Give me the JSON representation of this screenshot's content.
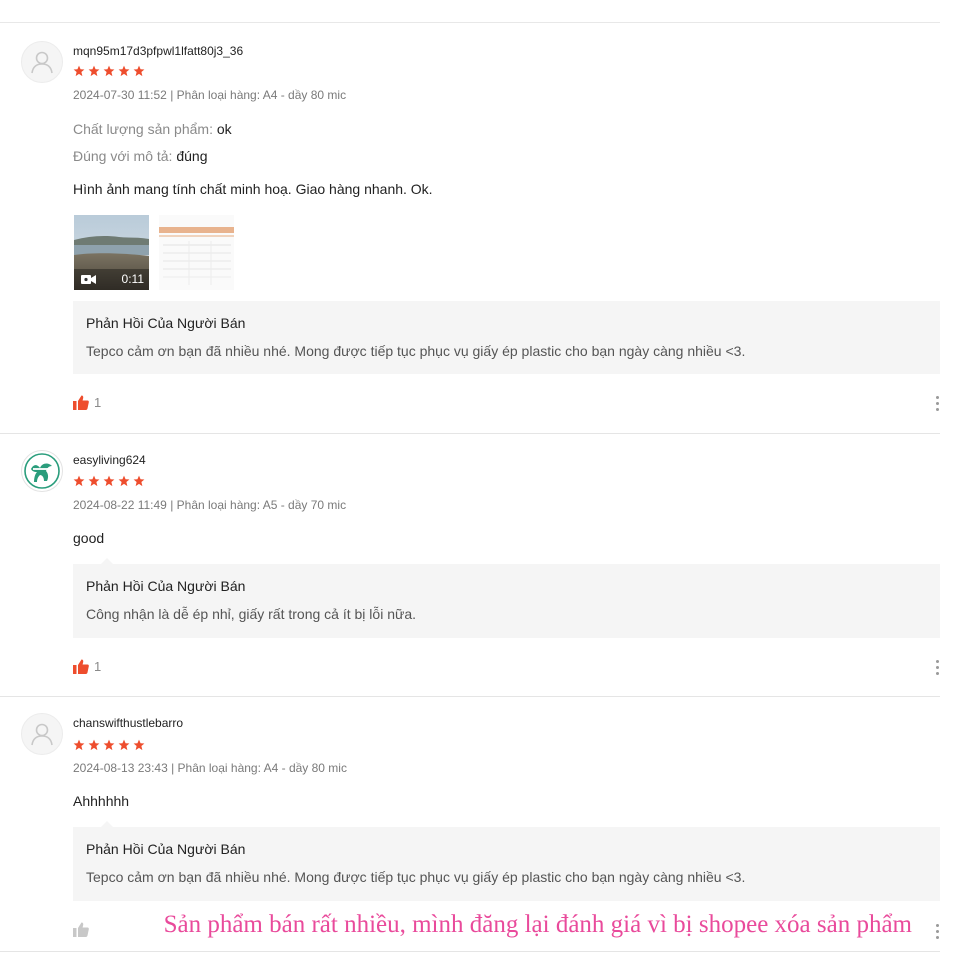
{
  "reviews": [
    {
      "username": "mqn95m17d3pfpwl1lfatt80j3_36",
      "rating": 5,
      "meta": "2024-07-30 11:52 | Phân loại hàng: A4 - dầy 80 mic",
      "attributes": [
        {
          "label": "Chất lượng sản phẩm:",
          "value": "ok"
        },
        {
          "label": "Đúng với mô tả:",
          "value": "đúng"
        }
      ],
      "text": "Hình ảnh mang tính chất minh hoạ. Giao hàng nhanh. Ok.",
      "video_duration": "0:11",
      "reply_title": "Phản Hồi Của Người Bán",
      "reply_text": "Tepco cảm ơn bạn đã nhiều nhé. Mong được tiếp tục phục vụ giấy ép plastic cho bạn ngày càng nhiều <3.",
      "likes": "1"
    },
    {
      "username": "easyliving624",
      "rating": 5,
      "meta": "2024-08-22 11:49 | Phân loại hàng: A5 - dầy 70 mic",
      "text": "good",
      "reply_title": "Phản Hồi Của Người Bán",
      "reply_text": "Công nhận là dễ ép nhỉ, giấy rất trong cả ít bị lỗi nữa.",
      "likes": "1"
    },
    {
      "username": "chanswifthustlebarro",
      "rating": 5,
      "meta": "2024-08-13 23:43 | Phân loại hàng: A4 - dầy 80 mic",
      "text": "Ahhhhhh",
      "reply_title": "Phản Hồi Của Người Bán",
      "reply_text": "Tepco cảm ơn bạn đã nhiều nhé. Mong được tiếp tục phục vụ giấy ép plastic cho bạn ngày càng nhiều <3."
    }
  ],
  "overlay_caption": "Sản phẩm bán rất nhiều, mình đăng lại đánh giá vì bị shopee xóa sản phẩm",
  "colors": {
    "star": "#ee4d2d",
    "caption": "#e94a9b",
    "reply_bg": "#f5f5f5"
  },
  "icons": [
    "default-avatar-icon",
    "easyliving-logo-icon",
    "star-icon",
    "thumbs-up-icon",
    "video-camera-icon",
    "more-vertical-icon"
  ]
}
